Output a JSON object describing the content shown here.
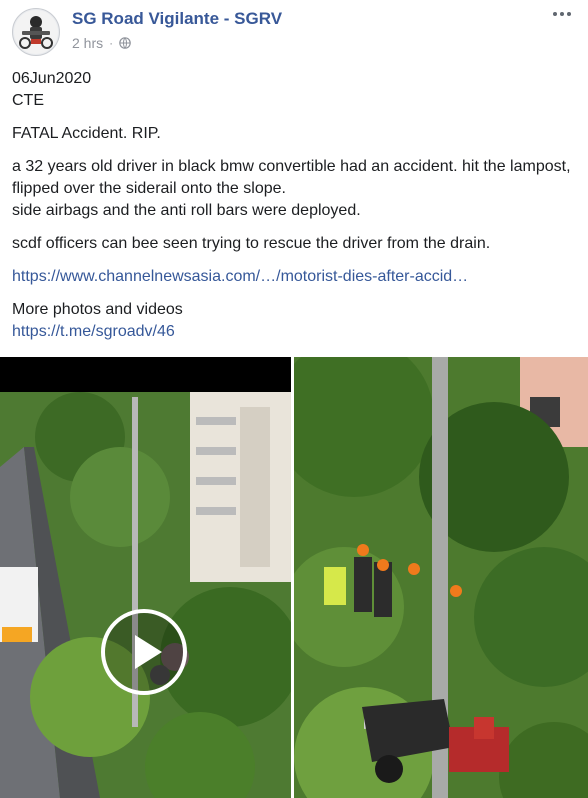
{
  "post": {
    "page_name": "SG Road Vigilante - SGRV",
    "timestamp": "2 hrs",
    "privacy_icon": "globe-icon",
    "more_icon": "ellipsis-icon",
    "avatar_icon": "sgrv-logo-avatar",
    "lines": {
      "date": "06Jun2020",
      "location": "CTE",
      "headline": "FATAL Accident. RIP.",
      "body1": "a 32 years old driver in black bmw convertible had an accident. hit the lampost, flipped over the siderail onto the slope.",
      "body2": "side airbags and the anti roll bars were deployed.",
      "body3": "scdf officers can bee seen trying to rescue the driver from the drain.",
      "link1": "https://www.channelnewsasia.com/…/motorist-dies-after-accid…",
      "more_label": "More photos and videos",
      "link2": "https://t.me/sgroadv/46"
    }
  },
  "media": {
    "video_play_icon": "play-icon"
  }
}
